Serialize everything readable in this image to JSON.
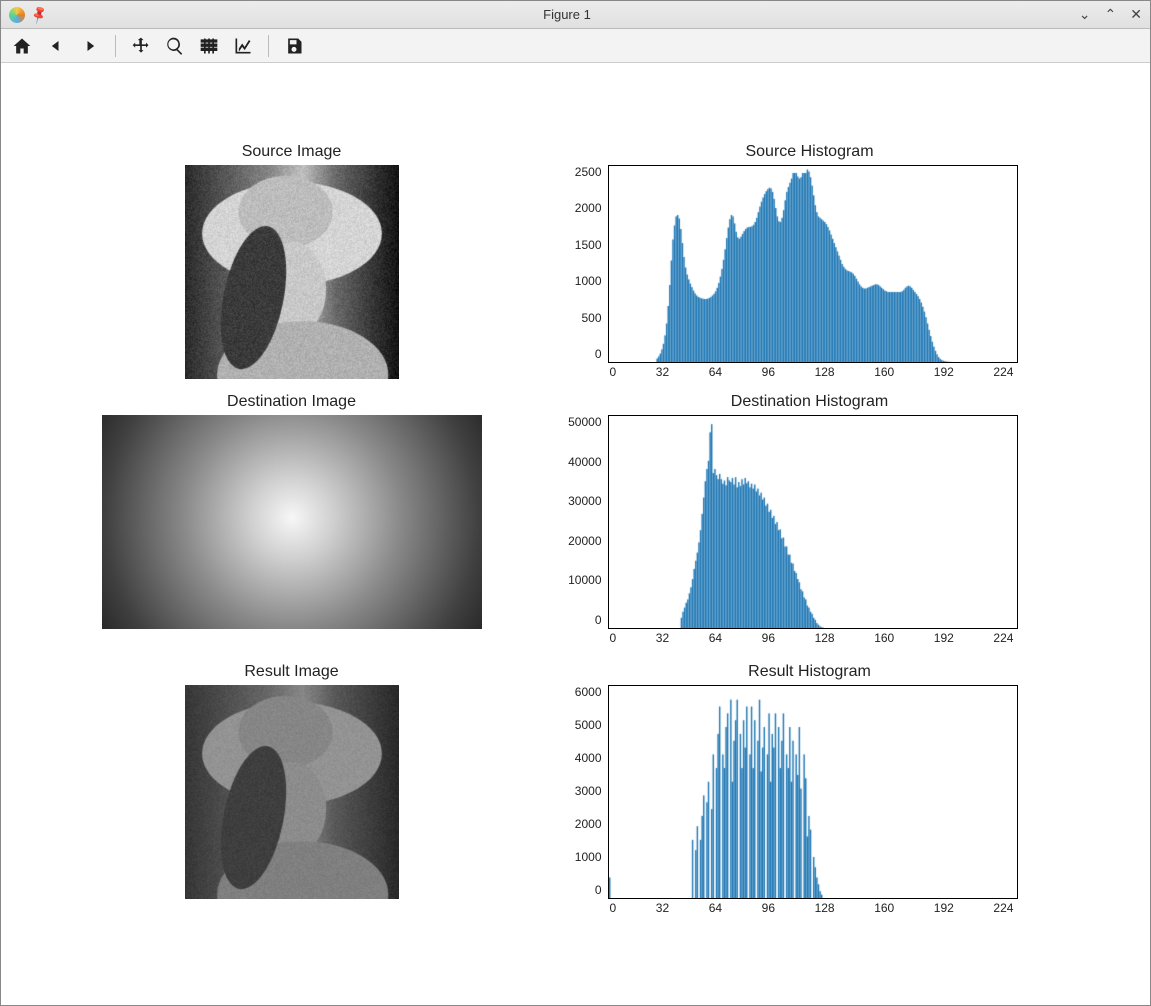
{
  "window": {
    "title": "Figure 1"
  },
  "toolbar": {
    "home": "home-icon",
    "back": "back-icon",
    "forward": "forward-icon",
    "pan": "pan-icon",
    "zoom": "zoom-icon",
    "subplots": "subplots-icon",
    "axes": "axes-icon",
    "save": "save-icon"
  },
  "panels": {
    "source_img": {
      "title": "Source Image"
    },
    "dest_img": {
      "title": "Destination Image"
    },
    "result_img": {
      "title": "Result Image"
    },
    "source_hist": {
      "title": "Source Histogram"
    },
    "dest_hist": {
      "title": "Destination Histogram"
    },
    "result_hist": {
      "title": "Result Histogram"
    }
  },
  "chart_data": [
    {
      "id": "source_hist",
      "type": "bar",
      "title": "Source Histogram",
      "xlabel": "",
      "ylabel": "",
      "xlim": [
        0,
        240
      ],
      "ylim": [
        0,
        2800
      ],
      "xticks": [
        0,
        32,
        64,
        96,
        128,
        160,
        192,
        224
      ],
      "yticks": [
        0,
        500,
        1000,
        1500,
        2000,
        2500
      ],
      "color": "#1f77b4",
      "values": [
        0,
        0,
        0,
        0,
        0,
        0,
        0,
        0,
        0,
        0,
        0,
        0,
        0,
        0,
        0,
        0,
        0,
        0,
        0,
        0,
        0,
        0,
        0,
        0,
        0,
        0,
        0,
        0,
        0,
        0,
        50,
        80,
        120,
        180,
        260,
        380,
        550,
        800,
        1100,
        1450,
        1750,
        1950,
        2080,
        2100,
        2050,
        1900,
        1700,
        1500,
        1350,
        1250,
        1180,
        1120,
        1070,
        1020,
        980,
        950,
        930,
        920,
        910,
        905,
        900,
        900,
        905,
        915,
        930,
        950,
        975,
        1010,
        1060,
        1130,
        1220,
        1330,
        1460,
        1610,
        1770,
        1920,
        2040,
        2100,
        2080,
        1980,
        1860,
        1780,
        1760,
        1790,
        1830,
        1870,
        1900,
        1920,
        1930,
        1930,
        1940,
        1960,
        2000,
        2060,
        2140,
        2220,
        2290,
        2350,
        2400,
        2440,
        2470,
        2490,
        2480,
        2430,
        2330,
        2200,
        2080,
        2010,
        2000,
        2060,
        2170,
        2310,
        2430,
        2500,
        2560,
        2620,
        2700,
        2700,
        2700,
        2650,
        2620,
        2640,
        2700,
        2700,
        2700,
        2750,
        2720,
        2640,
        2520,
        2380,
        2240,
        2140,
        2080,
        2060,
        2040,
        2020,
        2000,
        1970,
        1930,
        1880,
        1820,
        1760,
        1700,
        1640,
        1580,
        1520,
        1460,
        1400,
        1360,
        1330,
        1310,
        1300,
        1290,
        1280,
        1260,
        1230,
        1190,
        1150,
        1110,
        1080,
        1060,
        1050,
        1050,
        1060,
        1070,
        1080,
        1090,
        1100,
        1110,
        1110,
        1100,
        1080,
        1060,
        1040,
        1020,
        1010,
        1000,
        1000,
        1000,
        1000,
        1000,
        1000,
        1000,
        1000,
        1000,
        1010,
        1030,
        1060,
        1080,
        1090,
        1080,
        1060,
        1030,
        1000,
        970,
        940,
        900,
        850,
        790,
        720,
        640,
        550,
        460,
        370,
        290,
        220,
        160,
        110,
        70,
        45,
        28,
        18,
        12,
        8,
        5,
        3,
        2,
        1,
        1,
        0,
        0,
        0,
        0,
        0,
        0,
        0,
        0,
        0,
        0,
        0,
        0,
        0,
        0,
        0,
        0,
        0,
        0,
        0,
        0,
        0,
        0,
        0,
        0,
        0,
        0,
        0,
        0,
        0,
        0,
        0,
        0,
        0,
        0,
        0,
        0,
        0,
        0,
        0
      ]
    },
    {
      "id": "dest_hist",
      "type": "bar",
      "title": "Destination Histogram",
      "xlabel": "",
      "ylabel": "",
      "xlim": [
        0,
        224
      ],
      "ylim": [
        0,
        52000
      ],
      "xticks": [
        0,
        32,
        64,
        96,
        128,
        160,
        192,
        224
      ],
      "yticks": [
        0,
        10000,
        20000,
        30000,
        40000,
        50000
      ],
      "color": "#1f77b4",
      "values": [
        0,
        0,
        0,
        0,
        0,
        0,
        0,
        0,
        0,
        0,
        0,
        0,
        0,
        0,
        0,
        0,
        0,
        0,
        0,
        0,
        0,
        0,
        0,
        0,
        0,
        0,
        0,
        0,
        0,
        0,
        0,
        0,
        0,
        0,
        0,
        0,
        0,
        0,
        0,
        0,
        0,
        0,
        0,
        0,
        0,
        2500,
        4000,
        5000,
        6200,
        7000,
        8500,
        10000,
        12000,
        14500,
        16500,
        18500,
        21000,
        24000,
        28000,
        32000,
        36000,
        39000,
        41000,
        48000,
        50000,
        38000,
        39000,
        37500,
        36500,
        37800,
        36500,
        35400,
        36200,
        35000,
        37000,
        36200,
        35800,
        36800,
        35200,
        37000,
        34500,
        35800,
        34800,
        36500,
        35200,
        36800,
        35500,
        36000,
        34500,
        35400,
        34200,
        35200,
        33500,
        34200,
        32500,
        33200,
        31500,
        32000,
        30000,
        30500,
        28500,
        29000,
        27000,
        27500,
        25500,
        26000,
        24000,
        24200,
        22000,
        22200,
        20000,
        20000,
        18000,
        18000,
        16000,
        15800,
        14000,
        13500,
        12000,
        11200,
        9500,
        9000,
        7500,
        7000,
        5500,
        5000,
        4000,
        3500,
        2500,
        2000,
        1200,
        800,
        400,
        200,
        100,
        0,
        0,
        0,
        0,
        0,
        0,
        0,
        0,
        0,
        0,
        0,
        0,
        0,
        0,
        0,
        0,
        0,
        0,
        0,
        0,
        0,
        0,
        0,
        0,
        0,
        0,
        0,
        0,
        0,
        0,
        0,
        0,
        0,
        0,
        0,
        0,
        0,
        0,
        0,
        0,
        0,
        0,
        0,
        0,
        0,
        0,
        0,
        0,
        0,
        0,
        0,
        0,
        0,
        0,
        0,
        0,
        0,
        0,
        0,
        0,
        0,
        0,
        0,
        0,
        0,
        0,
        0,
        0,
        0,
        0,
        0,
        0,
        0,
        0,
        0,
        0,
        0,
        0,
        0,
        0,
        0,
        0,
        0,
        0,
        0,
        0,
        0,
        0,
        0,
        0,
        0,
        0,
        0,
        0,
        0,
        0,
        0,
        0,
        0,
        0,
        0,
        0,
        0,
        0,
        0,
        0,
        0,
        0,
        0,
        0,
        0,
        0,
        0,
        0,
        0,
        0,
        0,
        0,
        0,
        0,
        0
      ]
    },
    {
      "id": "result_hist",
      "type": "bar",
      "title": "Result Histogram",
      "xlabel": "",
      "ylabel": "",
      "xlim": [
        0,
        224
      ],
      "ylim": [
        0,
        6200
      ],
      "xticks": [
        0,
        32,
        64,
        96,
        128,
        160,
        192,
        224
      ],
      "yticks": [
        0,
        1000,
        2000,
        3000,
        4000,
        5000,
        6000
      ],
      "color": "#1f77b4",
      "values": [
        600,
        0,
        0,
        0,
        0,
        0,
        0,
        0,
        0,
        0,
        0,
        0,
        0,
        0,
        0,
        0,
        0,
        0,
        0,
        0,
        0,
        0,
        0,
        0,
        0,
        0,
        0,
        0,
        0,
        0,
        0,
        0,
        0,
        0,
        0,
        0,
        0,
        0,
        0,
        0,
        0,
        0,
        0,
        0,
        0,
        0,
        0,
        0,
        0,
        0,
        0,
        0,
        1700,
        0,
        1400,
        2100,
        0,
        1700,
        2400,
        3000,
        0,
        2800,
        3400,
        0,
        2600,
        4200,
        0,
        3800,
        4800,
        5600,
        0,
        4200,
        3800,
        5000,
        5400,
        0,
        5800,
        3400,
        4600,
        5200,
        5800,
        0,
        4800,
        3800,
        5200,
        4400,
        5600,
        0,
        4200,
        5600,
        3800,
        5200,
        0,
        4600,
        5800,
        3700,
        4400,
        5000,
        0,
        4200,
        5400,
        3400,
        4800,
        4400,
        5400,
        0,
        5000,
        3800,
        4600,
        5400,
        0,
        4200,
        3800,
        5000,
        3400,
        4600,
        0,
        4200,
        3600,
        5000,
        3200,
        0,
        4200,
        3500,
        1800,
        2400,
        2000,
        0,
        1200,
        900,
        600,
        400,
        200,
        100,
        0,
        0,
        0,
        0,
        0,
        0,
        0,
        0,
        0,
        0,
        0,
        0,
        0,
        0,
        0,
        0,
        0,
        0,
        0,
        0,
        0,
        0,
        0,
        0,
        0,
        0,
        0,
        0,
        0,
        0,
        0,
        0,
        0,
        0,
        0,
        0,
        0,
        0,
        0,
        0,
        0,
        0,
        0,
        0,
        0,
        0,
        0,
        0,
        0,
        0,
        0,
        0,
        0,
        0,
        0,
        0,
        0,
        0,
        0,
        0,
        0,
        0,
        0,
        0,
        0,
        0,
        0,
        0,
        0,
        0,
        0,
        0,
        0,
        0,
        0,
        0,
        0,
        0,
        0,
        0,
        0,
        0,
        0,
        0,
        0,
        0,
        0,
        0,
        0,
        0,
        0,
        0,
        0,
        0,
        0,
        0,
        0,
        0,
        0,
        0,
        0,
        0,
        0,
        0,
        0,
        0,
        0,
        0,
        0,
        0,
        0,
        0,
        0,
        0,
        0,
        0,
        0,
        0,
        0,
        0,
        0,
        0
      ]
    }
  ]
}
